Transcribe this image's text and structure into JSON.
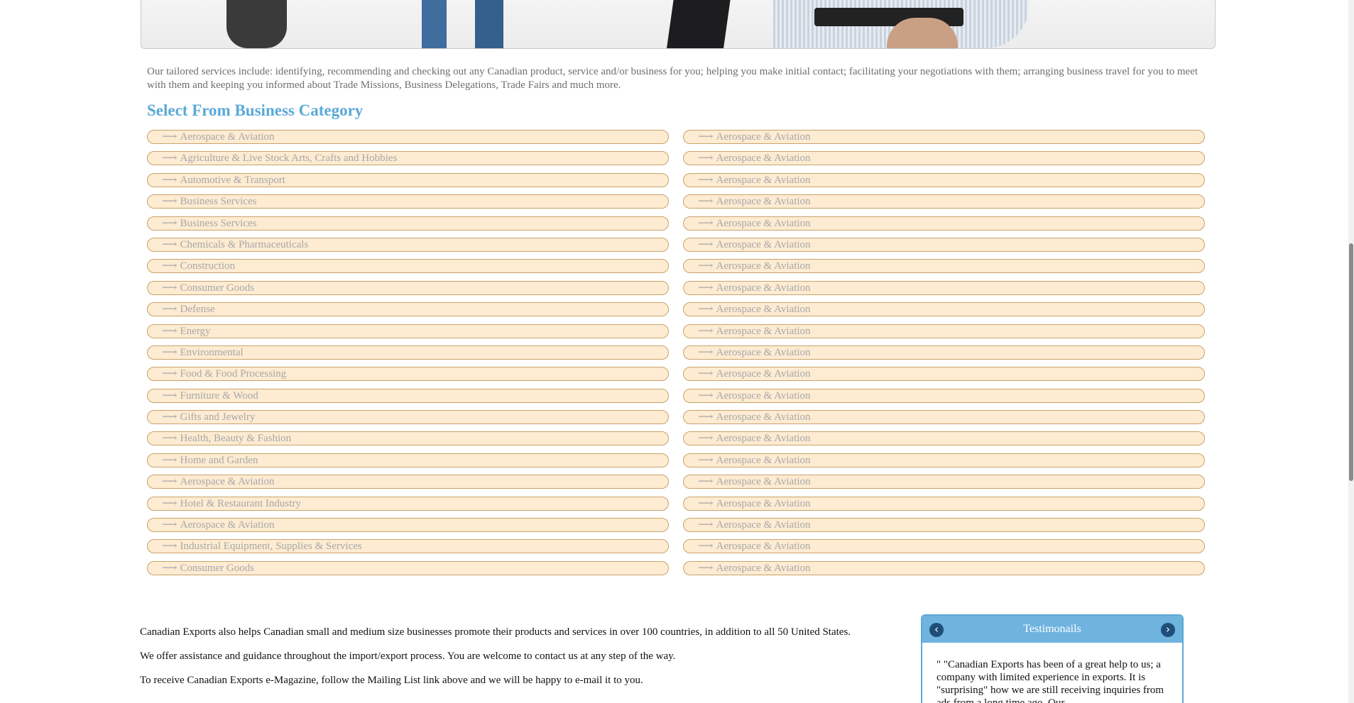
{
  "intro": {
    "text": "Our tailored services include: identifying, recommending and checking out any Canadian product, service and/or business for you; helping you make initial contact; facilitating your negotiations with them; arranging business travel for you to meet with them and keeping you informed about Trade Missions, Business Delegations, Trade Fairs and much more."
  },
  "categories": {
    "title": "Select From Business Category",
    "arrow": "⟶",
    "left": [
      "Aerospace & Aviation",
      "Agriculture & Live Stock Arts, Crafts and Hobbies",
      "Automotive & Transport",
      "Business Services",
      "Business Services",
      "Chemicals & Pharmaceuticals",
      "Construction",
      "Consumer Goods",
      "Defense",
      "Energy",
      "Environmental",
      "Food & Food Processing",
      "Furniture & Wood",
      "Gifts and Jewelry",
      "Health, Beauty & Fashion",
      "Home and Garden",
      "Aerospace & Aviation",
      "Hotel & Restaurant Industry",
      "Aerospace & Aviation",
      "Industrial Equipment, Supplies & Services",
      "Consumer Goods"
    ],
    "right": [
      "Aerospace & Aviation",
      "Aerospace & Aviation",
      "Aerospace & Aviation",
      "Aerospace & Aviation",
      "Aerospace & Aviation",
      "Aerospace & Aviation",
      "Aerospace & Aviation",
      "Aerospace & Aviation",
      "Aerospace & Aviation",
      "Aerospace & Aviation",
      "Aerospace & Aviation",
      "Aerospace & Aviation",
      "Aerospace & Aviation",
      "Aerospace & Aviation",
      "Aerospace & Aviation",
      "Aerospace & Aviation",
      "Aerospace & Aviation",
      "Aerospace & Aviation",
      "Aerospace & Aviation",
      "Aerospace & Aviation",
      "Aerospace & Aviation"
    ]
  },
  "info": {
    "p1": "Canadian Exports also helps Canadian small and medium size businesses promote their products and services in over 100 countries, in addition to all 50 United States.",
    "p2": "We offer assistance and guidance throughout the import/export process. You are welcome to contact us at any step of the way.",
    "p3": "To receive Canadian Exports e-Magazine, follow the Mailing List link above and we will be happy to e-mail it to you."
  },
  "testimonials": {
    "title": "Testimonails",
    "prev_icon": "‹",
    "next_icon": "›",
    "quote": "\" \"Canadian Exports has been of a great help to us; a company with limited experience in exports. It is \"surprising\" how we are still receiving inquiries from ads from a long time ago. Our"
  },
  "colors": {
    "heading": "#5aa9d6",
    "pill_bg": "#fdebd2",
    "pill_border": "#c9a36a",
    "pill_text": "#a8a8a8",
    "testimonial_header": "#6fb3df"
  }
}
